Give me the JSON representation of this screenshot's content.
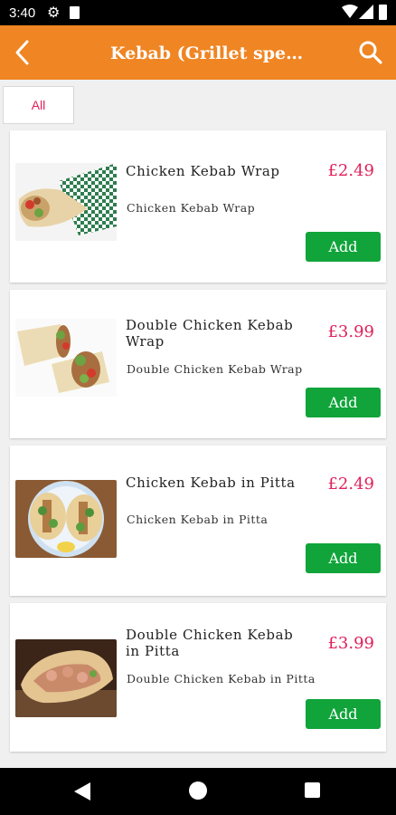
{
  "status_bar": {
    "time": "3:40"
  },
  "app_bar": {
    "title": "Kebab (Grillet speci..."
  },
  "tabs": [
    {
      "label": "All"
    }
  ],
  "items": [
    {
      "name": "Chicken Kebab Wrap",
      "description": "Chicken Kebab Wrap",
      "price": "£2.49",
      "add_label": "Add"
    },
    {
      "name": "Double Chicken Kebab Wrap",
      "description": "Double Chicken Kebab Wrap",
      "price": "£3.99",
      "add_label": "Add"
    },
    {
      "name": "Chicken Kebab in Pitta",
      "description": "Chicken Kebab in Pitta",
      "price": "£2.49",
      "add_label": "Add"
    },
    {
      "name": "Double Chicken Kebab in Pitta",
      "description": "Double Chicken Kebab in Pitta",
      "price": "£3.99",
      "add_label": "Add"
    }
  ],
  "colors": {
    "app_bar": "#ef8523",
    "price": "#e0205b",
    "add_button": "#10a43a",
    "tab_label": "#e0205b"
  },
  "icons": {
    "back": "chevron-left-icon",
    "search": "search-icon",
    "status": [
      "gear-icon",
      "sd-card-icon",
      "wifi-icon",
      "cell-signal-icon",
      "battery-icon"
    ],
    "nav": [
      "nav-back-icon",
      "nav-home-icon",
      "nav-recents-icon"
    ]
  }
}
